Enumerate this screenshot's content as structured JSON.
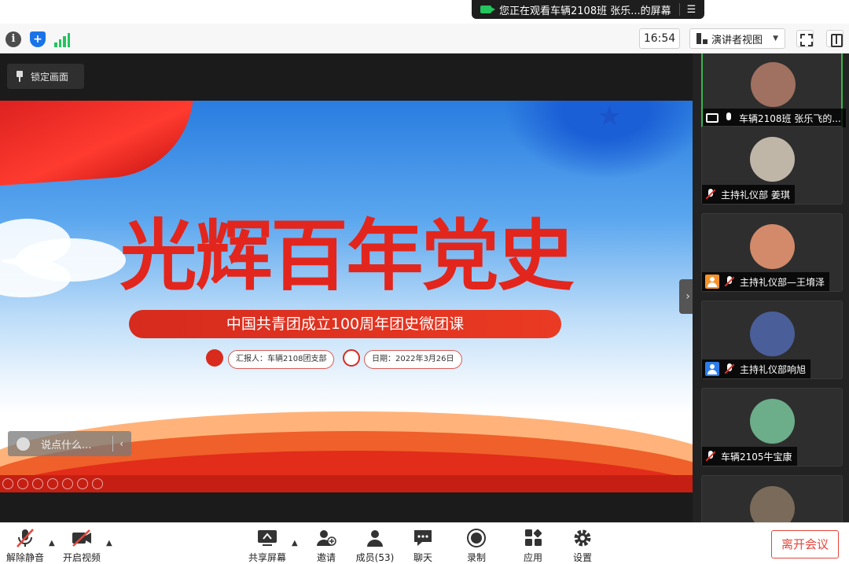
{
  "share_banner": {
    "text": "您正在观看车辆2108班 张乐...的屏幕",
    "menu_icon": "menu-icon"
  },
  "top_bar": {
    "clock": "16:54",
    "view_mode": "演讲者视图",
    "icons": [
      "info-icon",
      "shield-icon",
      "signal-icon",
      "fullscreen-icon",
      "panel-toggle-icon"
    ]
  },
  "stage": {
    "lock_label": "锁定画面"
  },
  "slide": {
    "title": "光辉百年党史",
    "subtitle": "中国共青团成立100周年团史微团课",
    "reporter": "汇报人：车辆2108团支部",
    "date": "日期：2022年3月26日"
  },
  "chat": {
    "placeholder": "说点什么..."
  },
  "participants": [
    {
      "name": "车辆2108班 张乐飞的...",
      "sharing": true,
      "mic": "on",
      "avatar_color": "#a07060"
    },
    {
      "name": "主持礼仪部 姜琪",
      "sharing": false,
      "mic": "off",
      "avatar_color": "#bfb6a8"
    },
    {
      "name": "主持礼仪部—王堉泽",
      "sharing": false,
      "mic": "off",
      "avatar_color": "#d28a6a",
      "badge_color": "#f5922b"
    },
    {
      "name": "主持礼仪部响旭",
      "sharing": false,
      "mic": "off",
      "avatar_color": "#4a5f99",
      "badge_color": "#2b7de9"
    },
    {
      "name": "车辆2105牛宝康",
      "sharing": false,
      "mic": "off",
      "avatar_color": "#6cae8a"
    },
    {
      "name": "",
      "sharing": false,
      "mic": "off",
      "avatar_color": "#7a6a5a"
    }
  ],
  "toolbar": {
    "unmute": "解除静音",
    "start_video": "开启视频",
    "share_screen": "共享屏幕",
    "invite": "邀请",
    "members": "成员(53)",
    "chat": "聊天",
    "record": "录制",
    "apps": "应用",
    "settings": "设置",
    "leave": "离开会议"
  },
  "colors": {
    "accent_green": "#22c55e",
    "leave_red": "#e4463c",
    "slide_red": "#e2261d"
  }
}
